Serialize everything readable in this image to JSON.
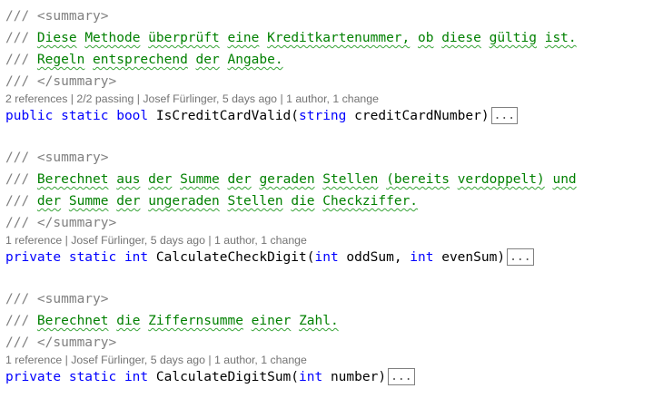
{
  "blocks": [
    {
      "summary_open": "/// <summary>",
      "doc_lines": [
        {
          "prefix": "/// ",
          "words": [
            "Diese",
            "Methode",
            "überprüft",
            "eine",
            "Kreditkartenummer,",
            "ob",
            "diese",
            "gültig",
            "ist."
          ]
        },
        {
          "prefix": "/// ",
          "words": [
            "Regeln",
            "entsprechend",
            "der",
            "Angabe."
          ]
        }
      ],
      "summary_close": "/// </summary>",
      "codelens": {
        "references": "2 references",
        "tests": "2/2 passing",
        "author": "Josef Fürlinger, 5 days ago",
        "changes": "1 author, 1 change",
        "separator": "|"
      },
      "signature": {
        "modifiers": "public static bool",
        "name": "IsCreditCardValid",
        "params": [
          {
            "type": "string",
            "name": "creditCardNumber"
          }
        ],
        "collapsed": "..."
      }
    },
    {
      "summary_open": "/// <summary>",
      "doc_lines": [
        {
          "prefix": "/// ",
          "words": [
            "Berechnet",
            "aus",
            "der",
            "Summe",
            "der",
            "geraden",
            "Stellen",
            "(bereits",
            "verdoppelt)",
            "und"
          ]
        },
        {
          "prefix": "/// ",
          "words": [
            "der",
            "Summe",
            "der",
            "ungeraden",
            "Stellen",
            "die",
            "Checkziffer."
          ]
        }
      ],
      "summary_close": "/// </summary>",
      "codelens": {
        "references": "1 reference",
        "author": "Josef Fürlinger, 5 days ago",
        "changes": "1 author, 1 change",
        "separator": "|"
      },
      "signature": {
        "modifiers": "private static int",
        "name": "CalculateCheckDigit",
        "params": [
          {
            "type": "int",
            "name": "oddSum"
          },
          {
            "type": "int",
            "name": "evenSum"
          }
        ],
        "collapsed": "..."
      }
    },
    {
      "summary_open": "/// <summary>",
      "doc_lines": [
        {
          "prefix": "/// ",
          "words": [
            "Berechnet",
            "die",
            "Ziffernsumme",
            "einer",
            "Zahl."
          ]
        }
      ],
      "summary_close": "/// </summary>",
      "codelens": {
        "references": "1 reference",
        "author": "Josef Fürlinger, 5 days ago",
        "changes": "1 author, 1 change",
        "separator": "|"
      },
      "signature": {
        "modifiers": "private static int",
        "name": "CalculateDigitSum",
        "params": [
          {
            "type": "int",
            "name": "number"
          }
        ],
        "collapsed": "..."
      }
    }
  ],
  "colors": {
    "comment_delimiter": "#808080",
    "doc_text": "#008000",
    "keyword": "#0000ff",
    "identifier": "#000000",
    "codelens": "#737373",
    "spelling_squiggle": "#36a336"
  }
}
